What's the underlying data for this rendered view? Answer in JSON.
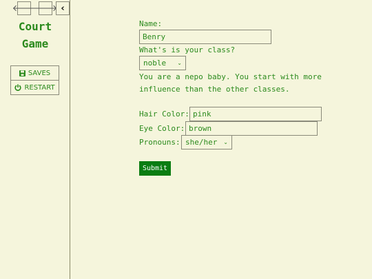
{
  "sidebar": {
    "back_icon": "arrow-left-icon",
    "forward_icon": "arrow-right-icon",
    "collapse_icon": "chevron-left-icon",
    "title_line1": "Court",
    "title_line2": "Game",
    "saves_label": "SAVES",
    "restart_label": "RESTART"
  },
  "form": {
    "name_label": "Name:",
    "name_value": "Benry",
    "class_question": "What's is your class?",
    "class_value": "noble",
    "class_description": "You are a nepo baby. You start with more influence than the other classes.",
    "hair_label": "Hair Color:",
    "hair_value": "pink",
    "eye_label": "Eye Color:",
    "eye_value": "brown",
    "pronouns_label": "Pronouns:",
    "pronouns_value": "she/her",
    "submit_label": "Submit"
  },
  "colors": {
    "background": "#f5f5dc",
    "text_green": "#2b8a1d",
    "submit_bg": "#0a7d12"
  }
}
